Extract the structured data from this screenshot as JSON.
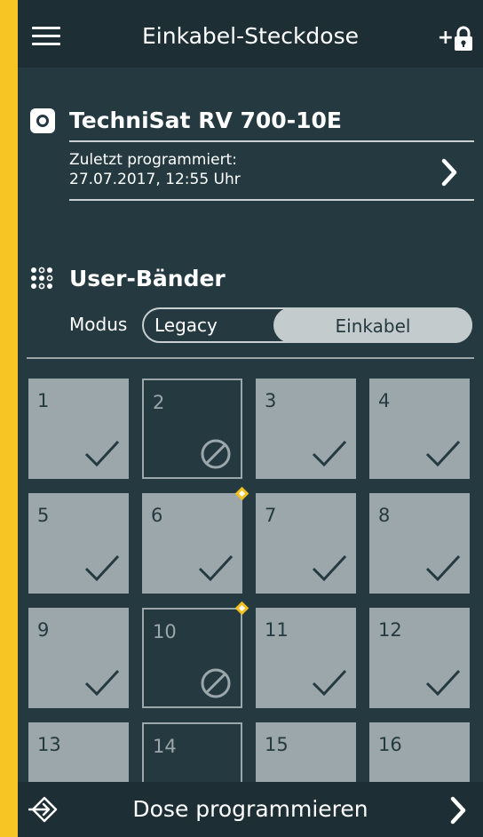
{
  "header": {
    "title": "Einkabel-Steckdose",
    "lock_plus": "+"
  },
  "device": {
    "name": "TechniSat RV 700-10E",
    "programmed_label": "Zuletzt programmiert:",
    "programmed_date": "27.07.2017, 12:55 Uhr"
  },
  "bands": {
    "title": "User-Bänder",
    "mode_label": "Modus",
    "options": [
      "Legacy",
      "Einkabel"
    ],
    "selected": "Einkabel"
  },
  "tiles": [
    {
      "number": "1",
      "status": "enabled"
    },
    {
      "number": "2",
      "status": "disabled"
    },
    {
      "number": "3",
      "status": "enabled"
    },
    {
      "number": "4",
      "status": "enabled"
    },
    {
      "number": "5",
      "status": "enabled"
    },
    {
      "number": "6",
      "status": "enabled",
      "marker": true
    },
    {
      "number": "7",
      "status": "enabled"
    },
    {
      "number": "8",
      "status": "enabled"
    },
    {
      "number": "9",
      "status": "enabled"
    },
    {
      "number": "10",
      "status": "disabled",
      "marker": true
    },
    {
      "number": "11",
      "status": "enabled"
    },
    {
      "number": "12",
      "status": "enabled"
    },
    {
      "number": "13",
      "status": "enabled"
    },
    {
      "number": "14",
      "status": "disabled"
    },
    {
      "number": "15",
      "status": "enabled"
    },
    {
      "number": "16",
      "status": "enabled"
    }
  ],
  "footer": {
    "action": "Dose programmieren"
  },
  "colors": {
    "accent": "#f7c624",
    "background": "#253a40",
    "bar": "#1d2f35",
    "tile": "#9ba7aa"
  }
}
